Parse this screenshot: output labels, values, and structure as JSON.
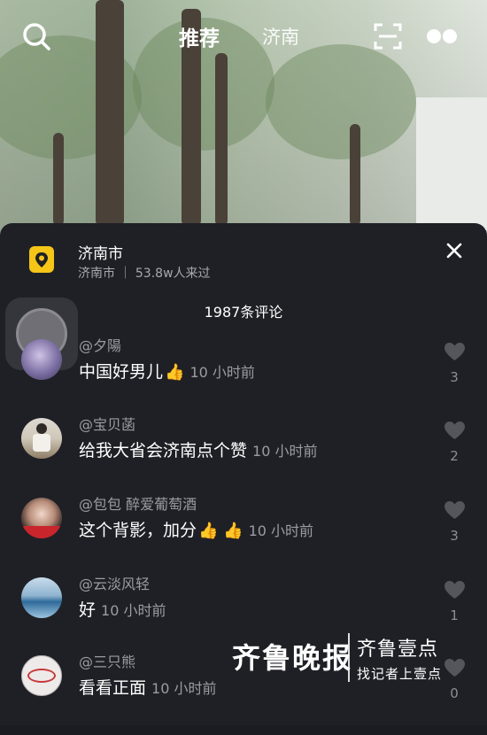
{
  "topbar": {
    "tab_recommend": "推荐",
    "tab_city": "济南",
    "icons": [
      "search-icon",
      "scan-icon",
      "more-icon"
    ]
  },
  "location": {
    "title": "济南市",
    "subtitle": "济南市 ｜ 53.8w人来过"
  },
  "comment_count": "1987条评论",
  "comments": [
    {
      "user": "@夕陽",
      "text": "中国好男儿",
      "emoji": "👍",
      "time": "10 小时前",
      "likes": "3"
    },
    {
      "user": "@宝贝菡",
      "text": "给我大省会济南点个赞",
      "emoji": "",
      "time": "10 小时前",
      "likes": "2"
    },
    {
      "user": "@包包 醉爱葡萄酒",
      "text": "这个背影，加分",
      "emoji": "👍 👍",
      "time": "10 小时前",
      "likes": "3"
    },
    {
      "user": "@云淡风轻",
      "text": "好",
      "emoji": "",
      "time": "10 小时前",
      "likes": "1"
    },
    {
      "user": "@三只熊",
      "text": "看看正面",
      "emoji": "",
      "time": "10 小时前",
      "likes": "0"
    }
  ],
  "watermark": {
    "left": "齐鲁晚报",
    "right_top": "齐鲁壹点",
    "right_bottom": "找记者上壹点"
  },
  "colors": {
    "panel_bg": "#1f2026",
    "location_icon": "#f5c518",
    "muted_text": "#9b9ca2"
  }
}
